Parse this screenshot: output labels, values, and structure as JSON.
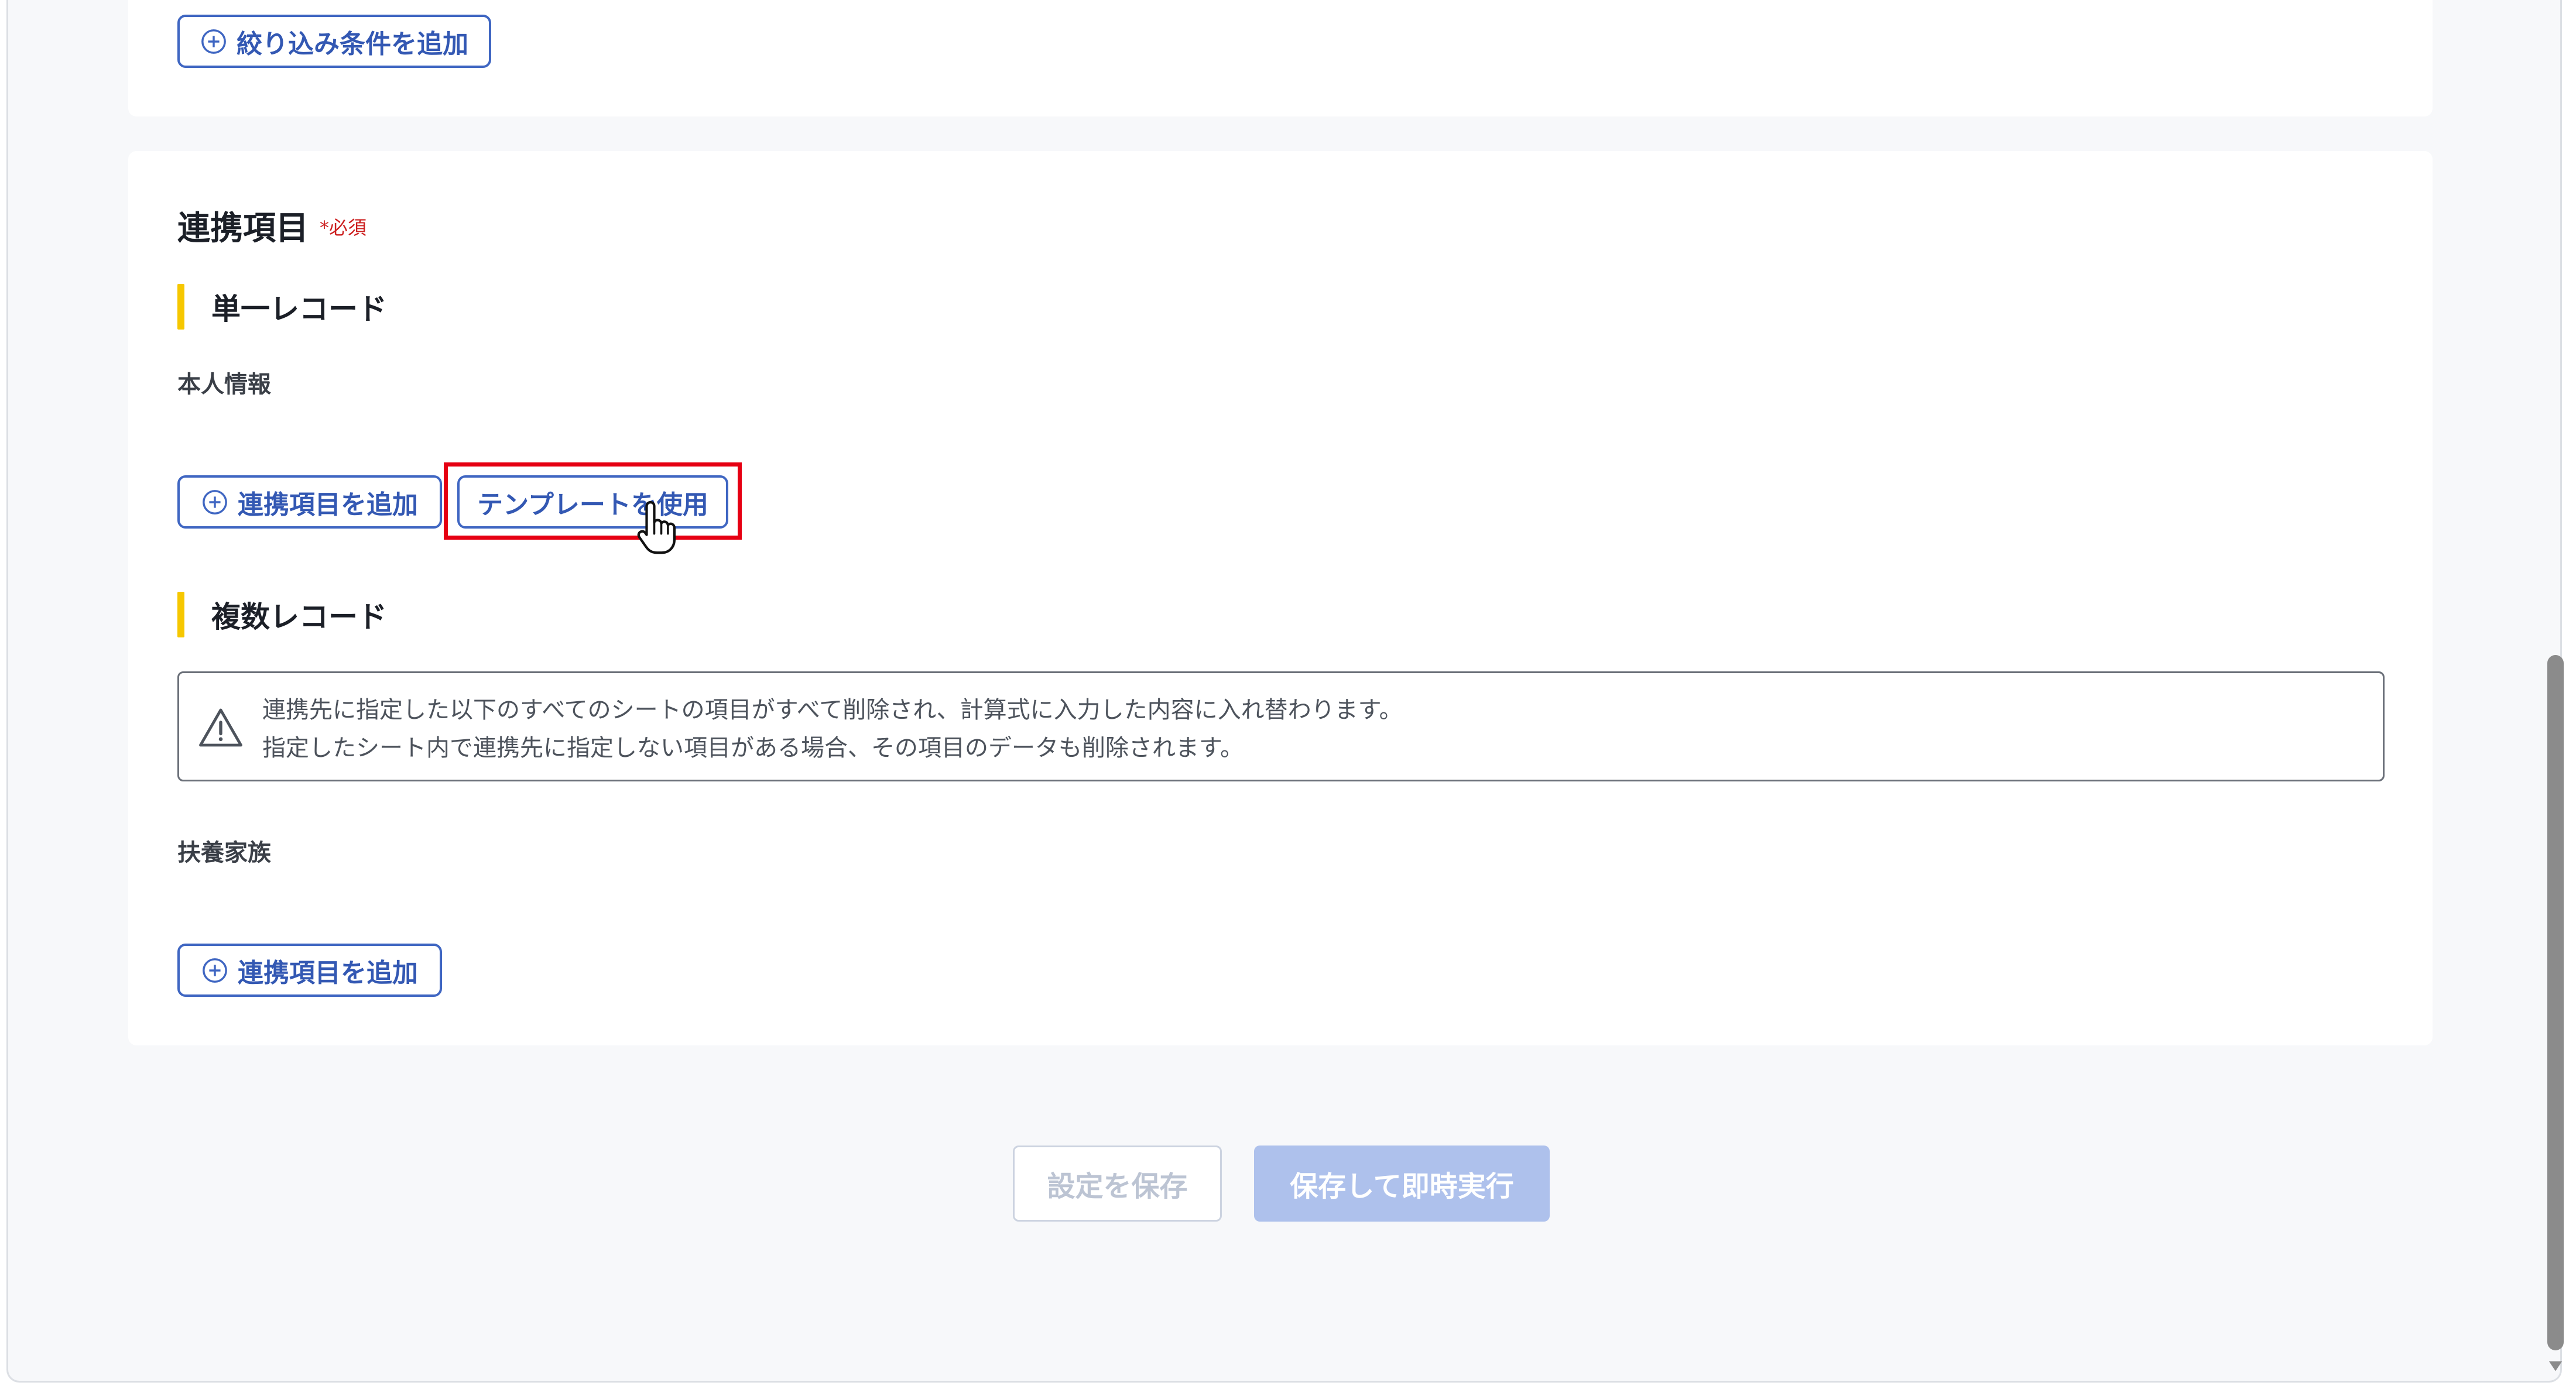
{
  "filter": {
    "add_condition_label": "絞り込み条件を追加"
  },
  "integration": {
    "title": "連携項目",
    "required_label": "*必須",
    "single_record": {
      "heading": "単一レコード",
      "group_label": "本人情報",
      "add_item_label": "連携項目を追加",
      "use_template_label": "テンプレートを使用"
    },
    "multi_record": {
      "heading": "複数レコード",
      "warning_line1": "連携先に指定した以下のすべてのシートの項目がすべて削除され、計算式に入力した内容に入れ替わります。",
      "warning_line2": "指定したシート内で連携先に指定しない項目がある場合、その項目のデータも削除されます。",
      "group_label": "扶養家族",
      "add_item_label": "連携項目を追加"
    }
  },
  "footer": {
    "save_settings_label": "設定を保存",
    "save_and_run_label": "保存して即時実行"
  },
  "colors": {
    "accent": "#3f66c2",
    "required": "#cc1f1f",
    "highlight": "#e60012",
    "section_bar": "#f6c700",
    "primary_disabled": "#aec1ec"
  },
  "icons": [
    "plus-circle-icon",
    "warning-triangle-icon",
    "hand-pointer-icon",
    "scroll-down-arrow-icon"
  ]
}
